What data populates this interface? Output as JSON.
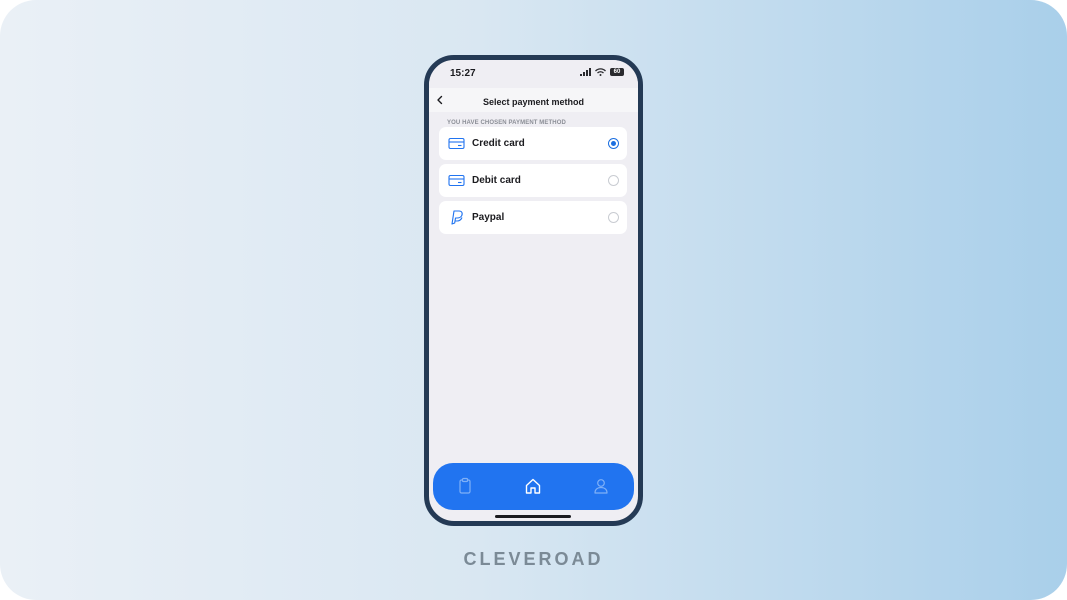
{
  "status_bar": {
    "time": "15:27",
    "battery": "60"
  },
  "header": {
    "title": "Select payment method"
  },
  "section": {
    "label": "YOU HAVE CHOSEN PAYMENT METHOD"
  },
  "options": [
    {
      "label": "Credit card",
      "icon": "credit-card-icon",
      "selected": true
    },
    {
      "label": "Debit card",
      "icon": "debit-card-icon",
      "selected": false
    },
    {
      "label": "Paypal",
      "icon": "paypal-icon",
      "selected": false
    }
  ],
  "bottom_nav": {
    "tabs": [
      "clipboard-icon",
      "home-icon",
      "user-icon"
    ],
    "active": "home-icon"
  },
  "brand": {
    "name": "CLEVEROAD"
  },
  "colors": {
    "accent": "#2174f0",
    "frame": "#243a55",
    "background": "#efeef3"
  }
}
